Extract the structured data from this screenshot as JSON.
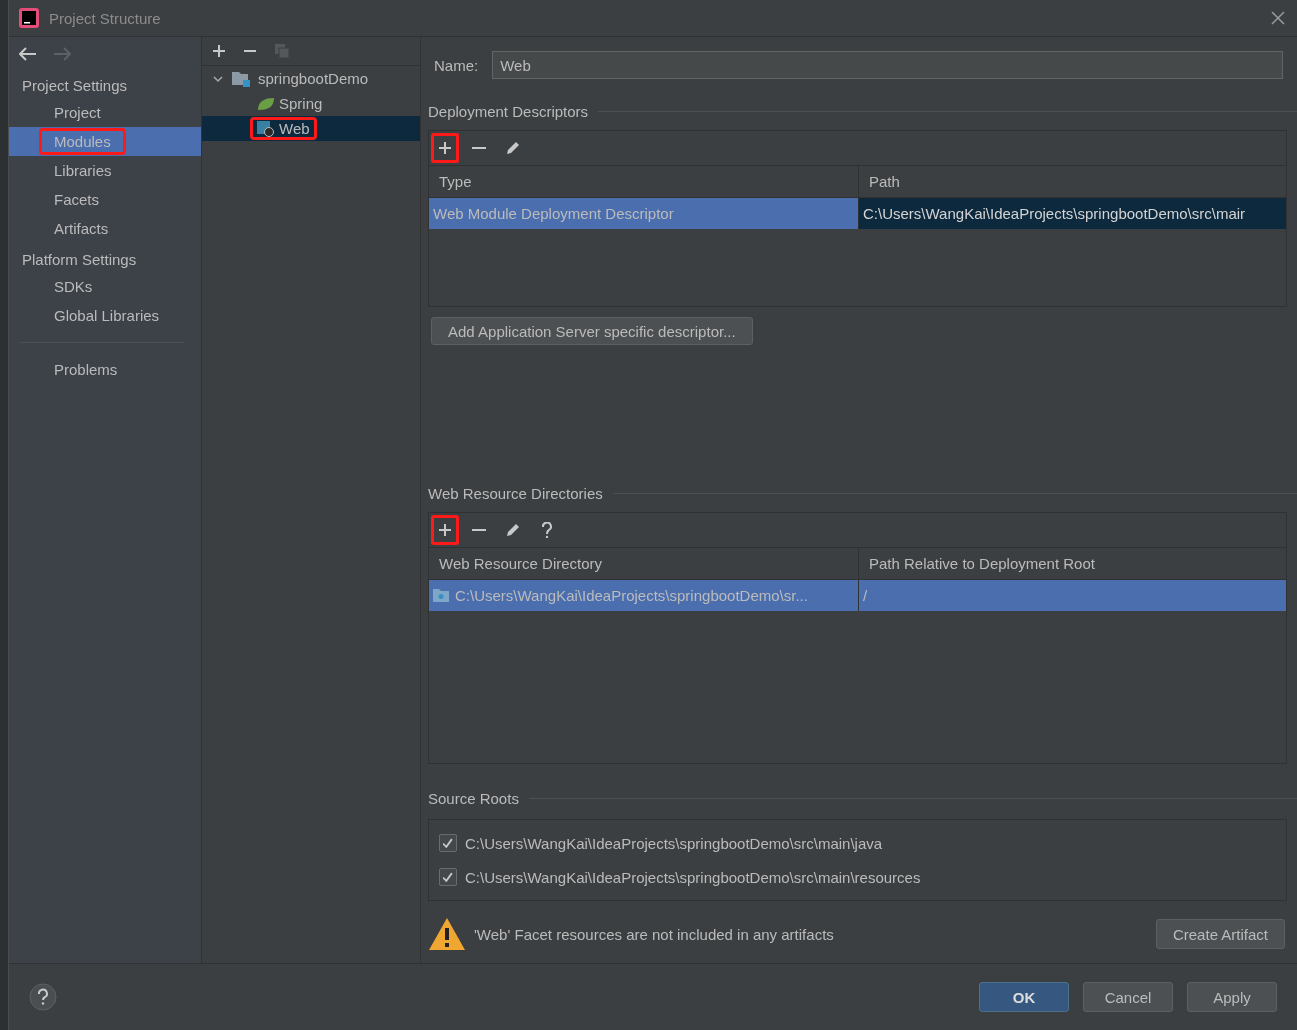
{
  "window": {
    "title": "Project Structure"
  },
  "sidebar": {
    "sections": [
      {
        "heading": "Project Settings",
        "items": [
          {
            "label": "Project",
            "selected": false,
            "highlighted": false
          },
          {
            "label": "Modules",
            "selected": true,
            "highlighted": true
          },
          {
            "label": "Libraries",
            "selected": false,
            "highlighted": false
          },
          {
            "label": "Facets",
            "selected": false,
            "highlighted": false
          },
          {
            "label": "Artifacts",
            "selected": false,
            "highlighted": false
          }
        ]
      },
      {
        "heading": "Platform Settings",
        "items": [
          {
            "label": "SDKs",
            "selected": false,
            "highlighted": false
          },
          {
            "label": "Global Libraries",
            "selected": false,
            "highlighted": false
          }
        ]
      }
    ],
    "problems": {
      "label": "Problems",
      "selected": false
    }
  },
  "tree": {
    "nodes": [
      {
        "label": "springbootDemo",
        "kind": "module",
        "expanded": true,
        "selected": false,
        "highlighted": false,
        "children": [
          {
            "label": "Spring",
            "kind": "spring",
            "selected": false,
            "highlighted": false
          },
          {
            "label": "Web",
            "kind": "web",
            "selected": true,
            "highlighted": true
          }
        ]
      }
    ]
  },
  "name_field": {
    "label": "Name:",
    "value": "Web"
  },
  "deployment_descriptors": {
    "title": "Deployment Descriptors",
    "toolbar": [
      {
        "kind": "add",
        "highlighted": true
      },
      {
        "kind": "remove",
        "highlighted": false
      },
      {
        "kind": "edit",
        "highlighted": false
      }
    ],
    "columns": [
      "Type",
      "Path"
    ],
    "rows": [
      {
        "selected": true,
        "cells": [
          {
            "text": "Web Module Deployment Descriptor",
            "kind": "selected"
          },
          {
            "text": "C:\\Users\\WangKai\\IdeaProjects\\springbootDemo\\src\\mair",
            "kind": "focused"
          }
        ]
      }
    ],
    "button": "Add Application Server specific descriptor..."
  },
  "web_resource_directories": {
    "title": "Web Resource Directories",
    "toolbar": [
      {
        "kind": "add",
        "highlighted": true
      },
      {
        "kind": "remove",
        "highlighted": false
      },
      {
        "kind": "edit",
        "highlighted": false
      },
      {
        "kind": "help",
        "highlighted": false
      }
    ],
    "columns": [
      "Web Resource Directory",
      "Path Relative to Deployment Root"
    ],
    "rows": [
      {
        "selected": true,
        "cells": [
          {
            "text": "C:\\Users\\WangKai\\IdeaProjects\\springbootDemo\\sr...",
            "kind": "selected"
          },
          {
            "text": "/",
            "kind": "selected"
          }
        ]
      }
    ]
  },
  "source_roots": {
    "title": "Source Roots",
    "items": [
      {
        "path": "C:\\Users\\WangKai\\IdeaProjects\\springbootDemo\\src\\main\\java",
        "checked": true
      },
      {
        "path": "C:\\Users\\WangKai\\IdeaProjects\\springbootDemo\\src\\main\\resources",
        "checked": true
      }
    ]
  },
  "warning": {
    "text": "'Web' Facet resources are not included in any artifacts",
    "button": "Create Artifact"
  },
  "footer": {
    "buttons": [
      {
        "label": "OK",
        "kind": "primary"
      },
      {
        "label": "Cancel",
        "kind": "normal"
      },
      {
        "label": "Apply",
        "kind": "normal"
      }
    ]
  }
}
